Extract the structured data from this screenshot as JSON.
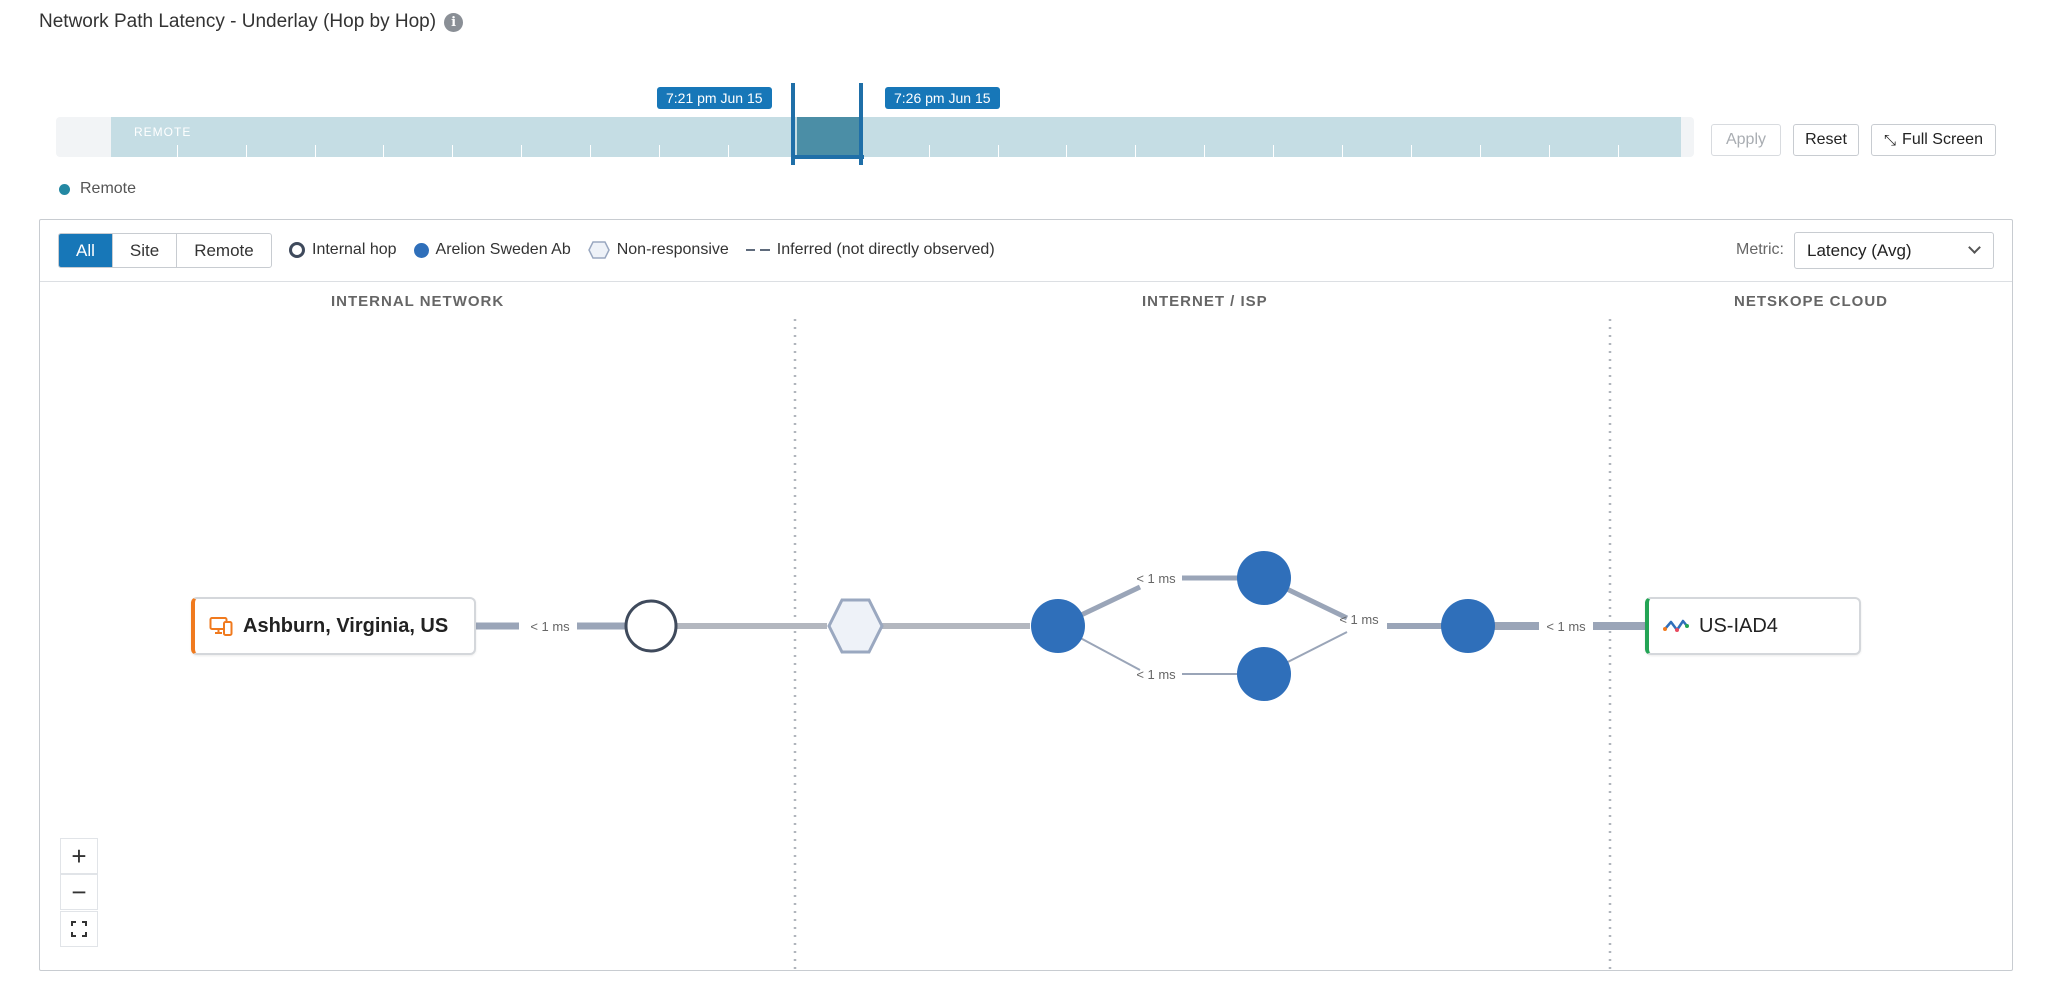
{
  "header": {
    "title": "Network Path Latency - Underlay (Hop by Hop)",
    "info_icon": "info-icon"
  },
  "timeline": {
    "band_label": "REMOTE",
    "start_time": "7:21 pm Jun 15",
    "end_time": "7:26 pm Jun 15"
  },
  "actions": {
    "apply": "Apply",
    "reset": "Reset",
    "fullscreen": "Full Screen"
  },
  "top_legend": {
    "remote": "Remote",
    "color": "#2488a3"
  },
  "filters": {
    "tabs": [
      "All",
      "Site",
      "Remote"
    ],
    "active": "All"
  },
  "legend": {
    "internal_hop": "Internal hop",
    "isp": "Arelion Sweden Ab",
    "non_responsive": "Non-responsive",
    "inferred": "Inferred (not directly observed)"
  },
  "metric": {
    "label": "Metric:",
    "value": "Latency (Avg)"
  },
  "sections": {
    "internal": "INTERNAL NETWORK",
    "internet": "INTERNET / ISP",
    "cloud": "NETSKOPE CLOUD"
  },
  "path": {
    "source": "Ashburn, Virginia, US",
    "destination": "US-IAD4",
    "latency_labels": [
      "< 1 ms",
      "< 1 ms",
      "< 1 ms",
      "< 1 ms",
      "< 1 ms"
    ]
  },
  "colors": {
    "accent": "#1777b8",
    "isp_node": "#2f6fba",
    "link": "#9aa5b8",
    "source_border": "#f07a1e",
    "dest_border": "#23a455"
  },
  "zoom": {
    "in": "+",
    "out": "−"
  }
}
